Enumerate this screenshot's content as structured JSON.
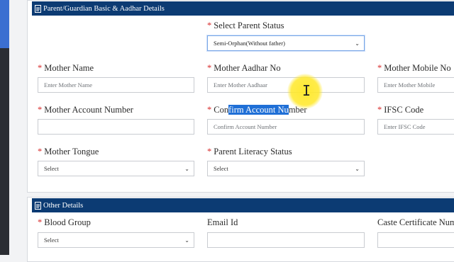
{
  "section1": {
    "header": "Parent/Guardian Basic & Aadhar Details",
    "parent_status": {
      "label": "Select Parent Status",
      "value": "Semi-Orphan(Without father)"
    },
    "mother_name": {
      "label": "Mother Name",
      "placeholder": "Enter Mother Name"
    },
    "mother_aadhar": {
      "label": "Mother Aadhar No",
      "placeholder": "Enter Mother Aadhaar"
    },
    "mother_mobile": {
      "label": "Mother Mobile No",
      "placeholder": "Enter Mother Mobile"
    },
    "mother_account": {
      "label": "Mother Account Number",
      "value": ""
    },
    "confirm_account": {
      "label_pre": "Con",
      "label_sel": "firm Account Nu",
      "label_post": "mber",
      "placeholder": "Confirm Account Number"
    },
    "ifsc": {
      "label": "IFSC Code",
      "placeholder": "Enter IFSC Code"
    },
    "mother_tongue": {
      "label": "Mother Tongue",
      "value": "Select"
    },
    "literacy": {
      "label": "Parent Literacy Status",
      "value": "Select"
    }
  },
  "section2": {
    "header": "Other Details",
    "blood_group": {
      "label": "Blood Group",
      "value": "Select"
    },
    "email": {
      "label": "Email Id",
      "value": ""
    },
    "caste_cert": {
      "label": "Caste Certificate Numb"
    }
  },
  "required_mark": "*",
  "chevron": "⌄",
  "colors": {
    "header_bg": "#0c3b73",
    "required": "#d72b2b",
    "selection": "#1f6fd6",
    "cursor_halo": "#ffe828"
  }
}
